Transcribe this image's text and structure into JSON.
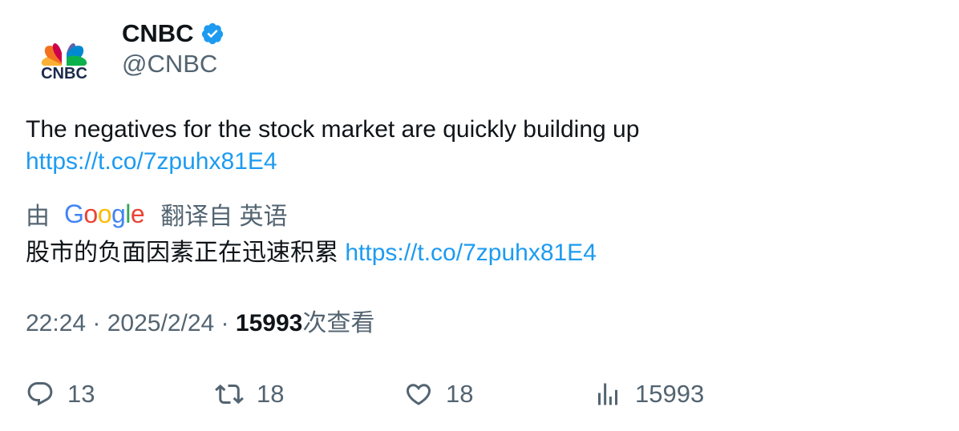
{
  "author": {
    "display_name": "CNBC",
    "handle": "@CNBC",
    "logo_text": "CNBC",
    "verified_icon": "verified-badge-icon"
  },
  "tweet": {
    "text": "The negatives for the stock market are quickly building up",
    "link": "https://t.co/7zpuhx81E4"
  },
  "translation": {
    "prefix": "由",
    "provider": "Google",
    "suffix": "翻译自 英语",
    "text": "股市的负面因素正在迅速积累",
    "link": "https://t.co/7zpuhx81E4"
  },
  "meta": {
    "time": "22:24",
    "separator": " · ",
    "date": "2025/2/24",
    "views_count": "15993",
    "views_label": "次查看"
  },
  "actions": {
    "replies": "13",
    "retweets": "18",
    "likes": "18",
    "views": "15993"
  },
  "colors": {
    "link": "#1d9bf0",
    "secondary_text": "#536471",
    "primary_text": "#0f1419",
    "verified": "#1d9bf0"
  },
  "icons": {
    "reply": "reply-icon",
    "retweet": "retweet-icon",
    "like": "heart-icon",
    "views": "views-chart-icon"
  }
}
